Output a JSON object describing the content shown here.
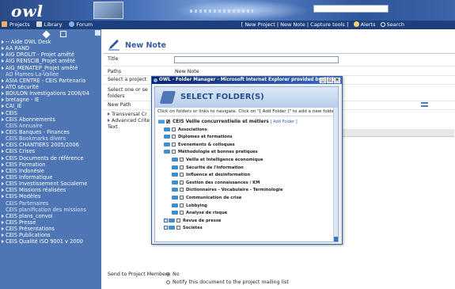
{
  "header": {
    "logo": "owl",
    "search_value": ""
  },
  "nav": {
    "left": [
      {
        "label": "Projects",
        "icon": "projects-icon"
      },
      {
        "label": "Library",
        "icon": "library-icon"
      },
      {
        "label": "Forum",
        "icon": "forum-icon"
      }
    ],
    "right": {
      "new_project": "[ New Project",
      "sep1": "|",
      "new_note": "New Note",
      "sep2": "|",
      "capture_tools": "Capture tools ]",
      "alerts": "Alerts",
      "search": "Search"
    }
  },
  "sidebar": {
    "items": [
      {
        "label": "-- Aide OWL Desk",
        "bullet": true
      },
      {
        "label": "AA RAND",
        "bullet": true
      },
      {
        "label": "AIG DROLIT - Projet amêté",
        "bullet": true
      },
      {
        "label": "AIG RENSCIB_Projet amêté",
        "bullet": true
      },
      {
        "label": "AIG_MENATEP_Projet amêté",
        "bullet": true
      },
      {
        "label": "AO Mames-La-Vallée",
        "bullet": false
      },
      {
        "label": "ASIA CENTRE - CEIS Partenaria",
        "bullet": true
      },
      {
        "label": "ATO sécurité",
        "bullet": true
      },
      {
        "label": "BOULON Investigations 2006/04",
        "bullet": true
      },
      {
        "label": "bretagne - iE",
        "bullet": true
      },
      {
        "label": "CAI_iE",
        "bullet": true
      },
      {
        "label": "CEIS",
        "bullet": true
      },
      {
        "label": "CEIS Abonnements",
        "bullet": true
      },
      {
        "label": "CEIS Annuaire",
        "bullet": false
      },
      {
        "label": "CEIS Banques - Finances",
        "bullet": true
      },
      {
        "label": "CEIS Bookmarks divers",
        "bullet": false
      },
      {
        "label": "CEIS CHANTIERS 2005/2006",
        "bullet": true
      },
      {
        "label": "CEIS Crises",
        "bullet": true
      },
      {
        "label": "CEIS Documents de référence",
        "bullet": true
      },
      {
        "label": "CEIS Formation",
        "bullet": true
      },
      {
        "label": "CEIS Indonésie",
        "bullet": true
      },
      {
        "label": "CEIS Informatique",
        "bullet": true
      },
      {
        "label": "CEIS Investissement Socialeme",
        "bullet": true
      },
      {
        "label": "CEIS Missions réalisées",
        "bullet": true
      },
      {
        "label": "CEIS Modèles",
        "bullet": true
      },
      {
        "label": "CEIS Partenaires",
        "bullet": false
      },
      {
        "label": "CEIS planification des missions",
        "bullet": false
      },
      {
        "label": "CEIS plans_convoi",
        "bullet": true
      },
      {
        "label": "CEIS Presse",
        "bullet": true
      },
      {
        "label": "CEIS Présentations",
        "bullet": true
      },
      {
        "label": "CEIS Publications",
        "bullet": true
      },
      {
        "label": "CEIS Qualité ISO 9001 v 2000",
        "bullet": true
      }
    ]
  },
  "form": {
    "heading": "New Note",
    "title_label": "Title",
    "title_value": "",
    "paths_label": "Paths",
    "paths_value": "New Note",
    "select_project_label": "Select a project",
    "select_one_label": "Select one or se",
    "folders_label": "folders",
    "new_path_label": "New Path",
    "transversal_label": "Transversal Cr",
    "advanced_label": "Advanced Crite",
    "text_label": "Text",
    "send_label": "Send to Project Members",
    "radio_no": "No",
    "radio_notify": "Notify this document to the project mailing list"
  },
  "dialog": {
    "window_title": "OWL - Folder Manager - Microsoft Internet Explorer provided by CEIS",
    "heading": "SELECT FOLDER(S)",
    "instructions": "Click on folders or links to navigate. Click on \"[ Add Folder ]\" to add a new folder.",
    "root": {
      "label": "CEIS Veille concurrentielle et métiers",
      "add": "[ Add Folder ]"
    },
    "folders": [
      {
        "label": "Associations",
        "level": 1
      },
      {
        "label": "Diplomes et formations",
        "level": 1
      },
      {
        "label": "Evénements & colloques",
        "level": 1
      },
      {
        "label": "Méthodologie et bonnes pratiques",
        "level": 1
      },
      {
        "label": "Veille et Intelligence économique",
        "level": 2
      },
      {
        "label": "Sécurité de l'information",
        "level": 2
      },
      {
        "label": "Influence et désinformation",
        "level": 2
      },
      {
        "label": "Gestion des connaissances / KM",
        "level": 2
      },
      {
        "label": "Dictionnaires - Vocabulaire - Terminologie",
        "level": 2
      },
      {
        "label": "Communication de crise",
        "level": 2
      },
      {
        "label": "Lobbying",
        "level": 2
      },
      {
        "label": "Analyse de risque",
        "level": 2
      },
      {
        "label": "Revue de presse",
        "level": 1
      },
      {
        "label": "Sociétés",
        "level": 1
      }
    ]
  }
}
